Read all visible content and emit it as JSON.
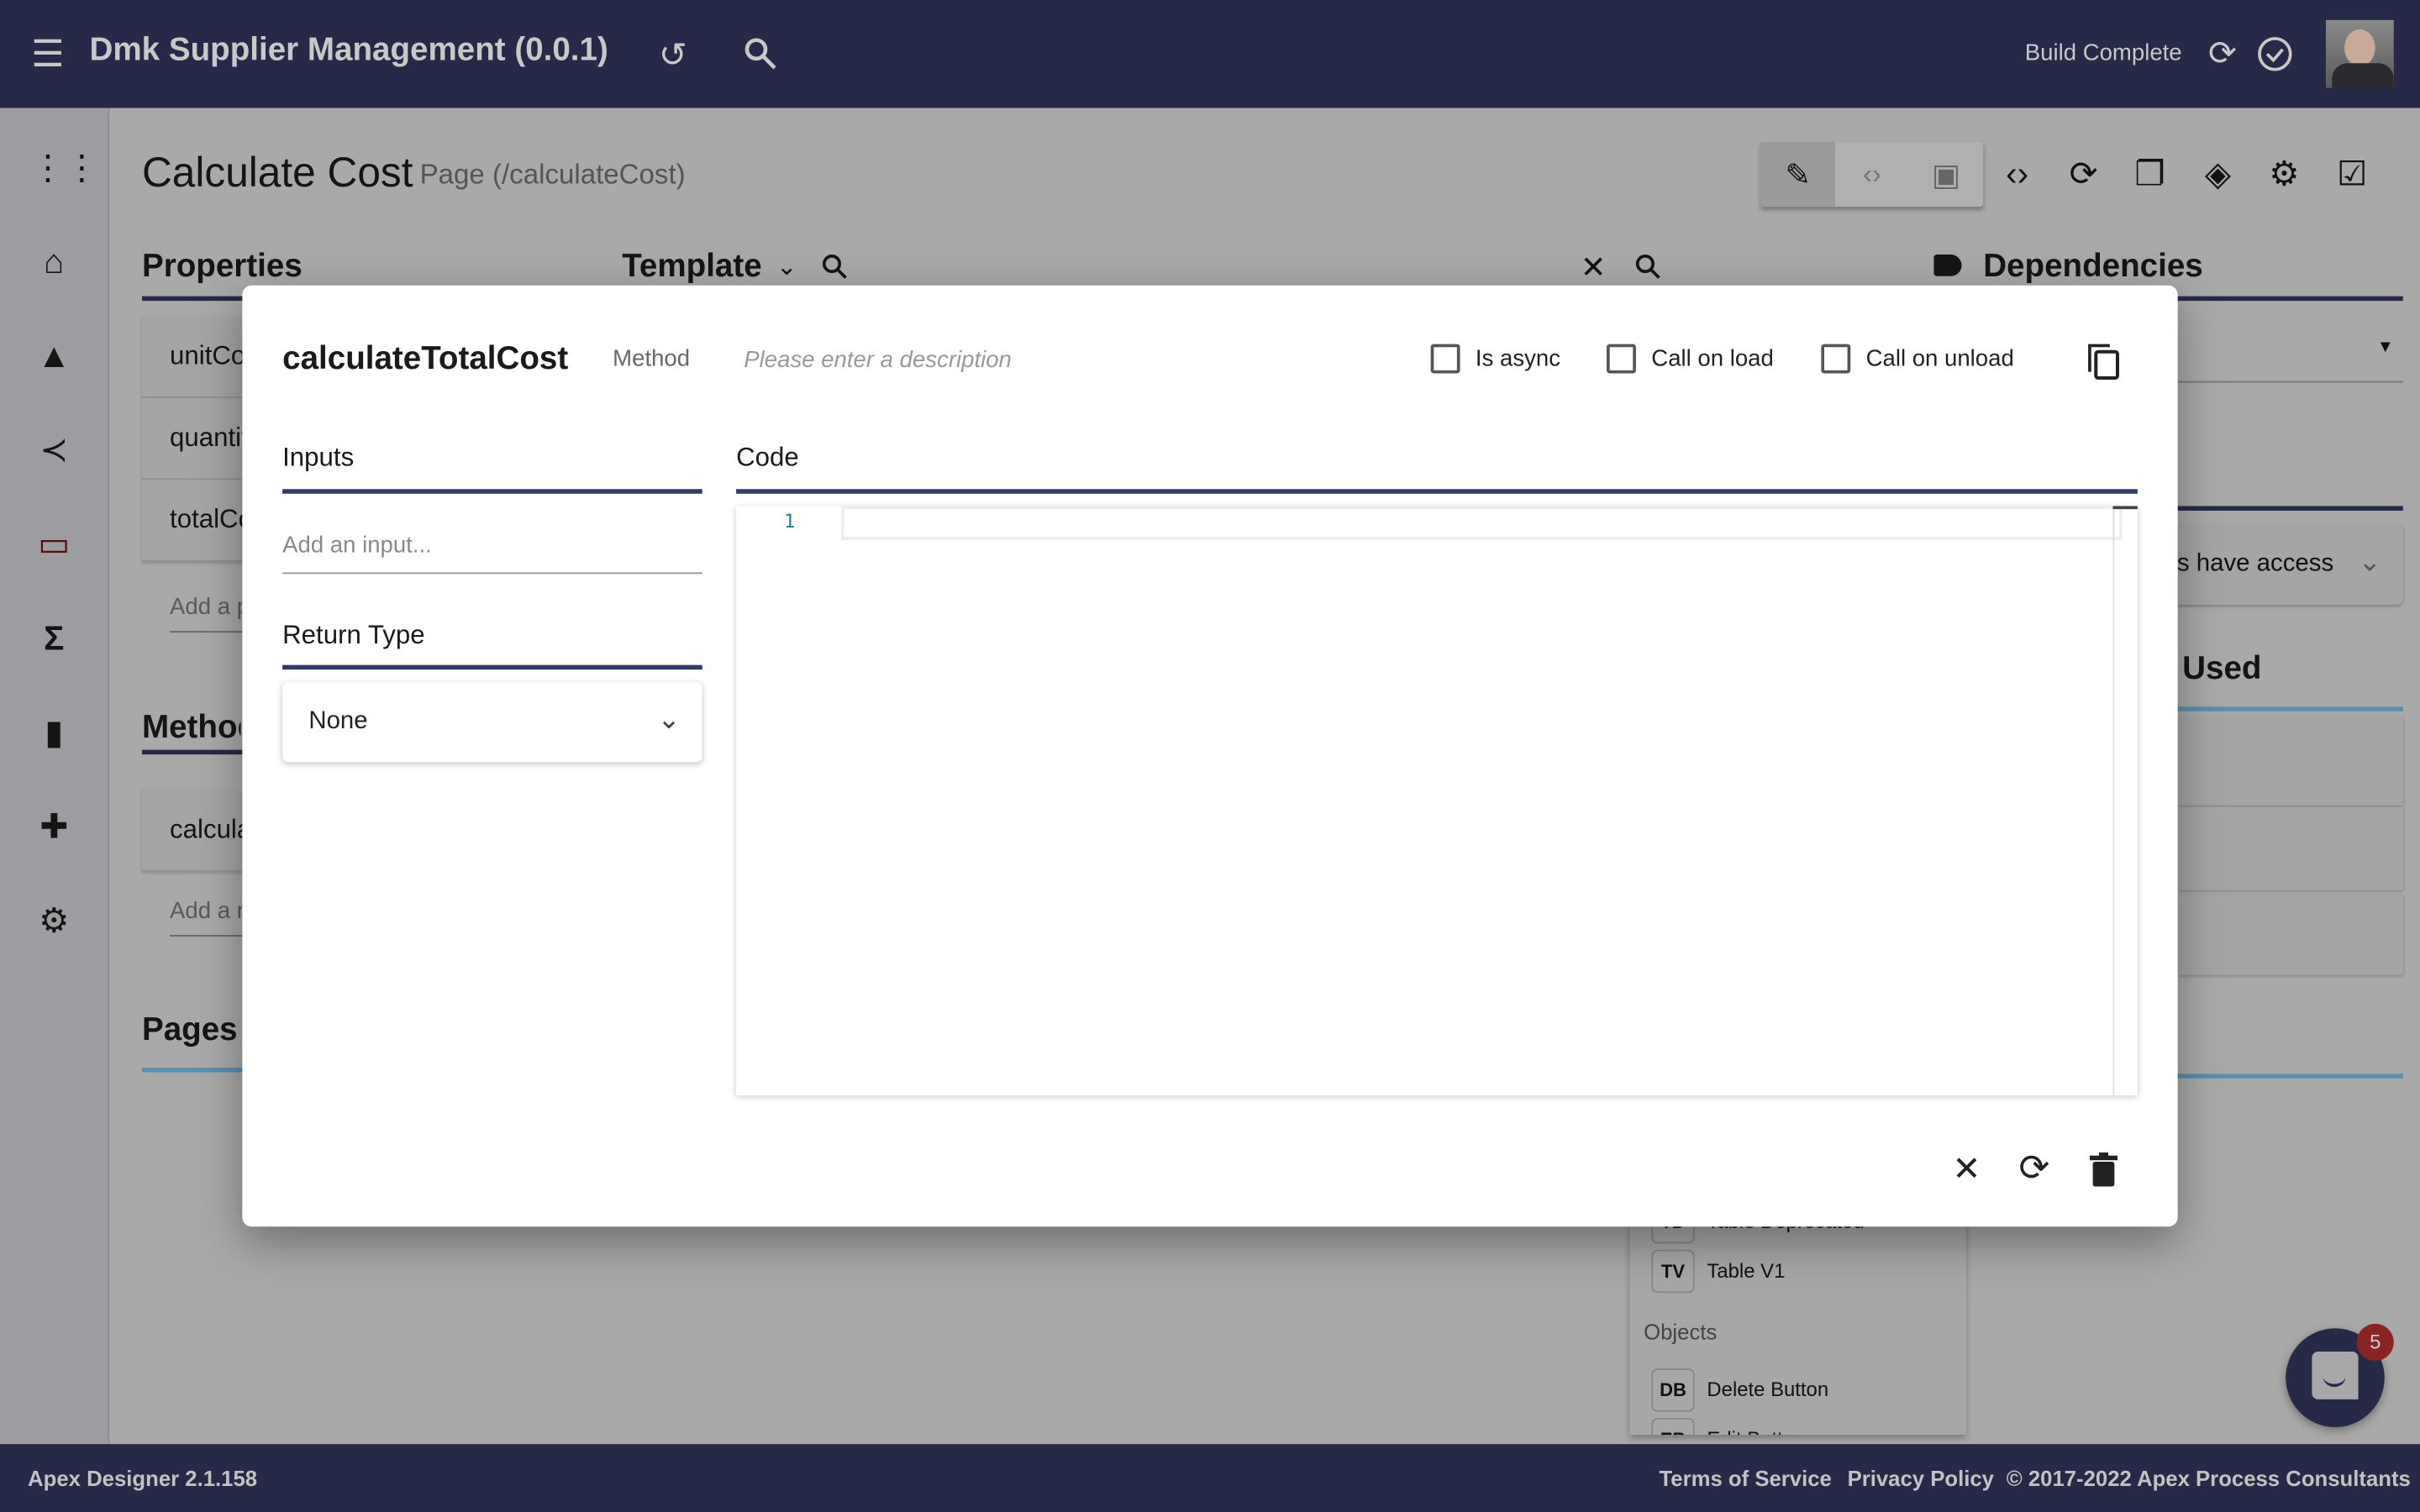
{
  "app": {
    "title": "Dmk Supplier Management (0.0.1)",
    "build_status": "Build Complete",
    "colors": {
      "primary": "#262a48",
      "accent_underline": "#5b8fb0",
      "badge": "#8b2323"
    }
  },
  "page": {
    "title": "Calculate Cost",
    "subtitle": "Page (/calculateCost)"
  },
  "sections": {
    "properties": {
      "title": "Properties",
      "items": [
        "unitCost",
        "quantity",
        "totalCost"
      ],
      "add_placeholder": "Add a property..."
    },
    "methods": {
      "title": "Methods",
      "items": [
        "calculateTotalCost"
      ],
      "add_placeholder": "Add a method..."
    },
    "pages": {
      "title": "Pages"
    },
    "template": {
      "title": "Template"
    },
    "dependencies": {
      "title": "Dependencies"
    },
    "access": {
      "value": "All users have access"
    },
    "used": {
      "title": "Used"
    },
    "palette": {
      "items": [
        {
          "abbr": "TD",
          "label": "Table Deprecated"
        },
        {
          "abbr": "TV",
          "label": "Table V1"
        }
      ],
      "group": "Objects",
      "objects": [
        {
          "abbr": "DB",
          "label": "Delete Button"
        },
        {
          "abbr": "EB",
          "label": "Edit Button"
        }
      ]
    }
  },
  "dialog": {
    "name": "calculateTotalCost",
    "type": "Method",
    "description_placeholder": "Please enter a description",
    "checkboxes": [
      {
        "label": "Is async",
        "checked": false
      },
      {
        "label": "Call on load",
        "checked": false
      },
      {
        "label": "Call on unload",
        "checked": false
      }
    ],
    "inputs_title": "Inputs",
    "add_input_placeholder": "Add an input...",
    "return_type_title": "Return Type",
    "return_type": "None",
    "code_title": "Code",
    "line_numbers": [
      "1"
    ]
  },
  "chat": {
    "badge_count": "5"
  },
  "footer": {
    "version": "Apex Designer 2.1.158",
    "terms": "Terms of Service",
    "privacy": "Privacy Policy",
    "copyright": "© 2017-2022 Apex Process Consultants"
  }
}
